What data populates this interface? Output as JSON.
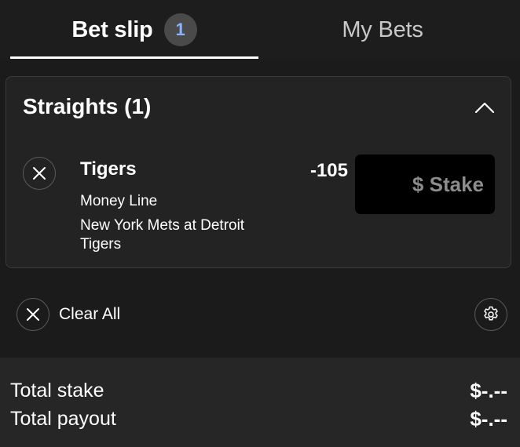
{
  "tabs": {
    "betslip": {
      "label": "Bet slip",
      "count": "1"
    },
    "mybets": {
      "label": "My Bets"
    }
  },
  "straights": {
    "title": "Straights (1)",
    "selection": {
      "team": "Tigers",
      "market": "Money Line",
      "event": "New York Mets at Detroit Tigers",
      "odds": "-105",
      "stake_placeholder": "$ Stake"
    }
  },
  "actions": {
    "clear_all": "Clear All"
  },
  "totals": {
    "stake_label": "Total stake",
    "stake_value": "$-.--",
    "payout_label": "Total payout",
    "payout_value": "$-.--"
  },
  "colors": {
    "background": "#1b1b1b",
    "card": "#232323",
    "badge": "#4a4a4a",
    "badge_text": "#8ab4ff",
    "stake_box": "#000000"
  },
  "icons": [
    "close-icon",
    "chevron-up-icon",
    "gear-icon"
  ]
}
